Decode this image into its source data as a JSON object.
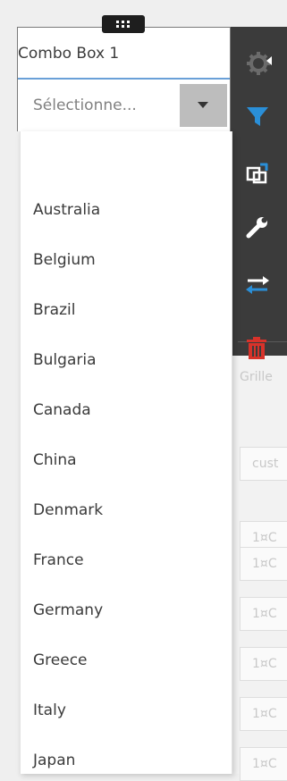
{
  "combo": {
    "title": "Combo Box 1",
    "placeholder": "Sélectionne...",
    "options": [
      "",
      "Australia",
      "Belgium",
      "Brazil",
      "Bulgaria",
      "Canada",
      "China",
      "Denmark",
      "France",
      "Germany",
      "Greece",
      "Italy",
      "Japan"
    ]
  },
  "grid": {
    "header": "Grille",
    "cells": [
      "cust",
      "1¤C",
      "1¤C",
      "1¤C",
      "1¤C",
      "1¤C",
      "1¤C"
    ]
  },
  "toolbar": {
    "icons": [
      "gear-icon",
      "filter-icon",
      "resize-icon",
      "wrench-icon",
      "swap-icon",
      "trash-icon"
    ],
    "colors": {
      "filter": "#2a8fd8",
      "swap": "#2a8fd8",
      "trash": "#d8322a",
      "neutral": "#ffffff"
    }
  }
}
